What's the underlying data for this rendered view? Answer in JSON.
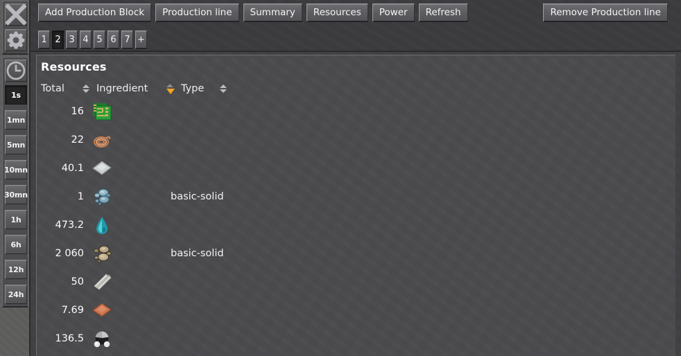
{
  "left_rail": {
    "tool_buttons": [
      {
        "name": "close-icon",
        "label": "X"
      },
      {
        "name": "gear-icon",
        "label": "Settings"
      }
    ],
    "clock_button": {
      "name": "clock-icon",
      "label": "Time"
    },
    "time_options": [
      {
        "label": "1s",
        "active": true
      },
      {
        "label": "1mn",
        "active": false
      },
      {
        "label": "5mn",
        "active": false
      },
      {
        "label": "10mn",
        "active": false
      },
      {
        "label": "30mn",
        "active": false
      },
      {
        "label": "1h",
        "active": false
      },
      {
        "label": "6h",
        "active": false
      },
      {
        "label": "12h",
        "active": false
      },
      {
        "label": "24h",
        "active": false
      }
    ]
  },
  "topbar": {
    "buttons": [
      "Add Production Block",
      "Production line",
      "Summary",
      "Resources",
      "Power",
      "Refresh"
    ],
    "remove_button": "Remove Production line",
    "tabs": [
      {
        "label": "1",
        "active": false
      },
      {
        "label": "2",
        "active": true
      },
      {
        "label": "3",
        "active": false
      },
      {
        "label": "4",
        "active": false
      },
      {
        "label": "5",
        "active": false
      },
      {
        "label": "6",
        "active": false
      },
      {
        "label": "7",
        "active": false
      },
      {
        "label": "+",
        "active": false
      }
    ]
  },
  "panel": {
    "title": "Resources",
    "columns": [
      {
        "label": "Total",
        "sort": "inactive"
      },
      {
        "label": "Ingredient",
        "sort": "desc"
      },
      {
        "label": "Type",
        "sort": "inactive"
      }
    ],
    "rows": [
      {
        "total": "16",
        "icon": "electronic-circuit-icon",
        "type": ""
      },
      {
        "total": "22",
        "icon": "copper-cable-icon",
        "type": ""
      },
      {
        "total": "40.1",
        "icon": "iron-plate-icon",
        "type": ""
      },
      {
        "total": "1",
        "icon": "iron-ore-icon",
        "type": "basic-solid"
      },
      {
        "total": "473.2",
        "icon": "water-icon",
        "type": ""
      },
      {
        "total": "2 060",
        "icon": "stone-icon",
        "type": "basic-solid"
      },
      {
        "total": "50",
        "icon": "steel-plate-icon",
        "type": ""
      },
      {
        "total": "7.69",
        "icon": "copper-plate-icon",
        "type": ""
      },
      {
        "total": "136.5",
        "icon": "petroleum-gas-icon",
        "type": ""
      }
    ]
  },
  "colors": {
    "accent_sort": "#f3a526",
    "panel_bg": "#4b4b4e",
    "window_bg": "#414143",
    "text": "#ffffff"
  }
}
